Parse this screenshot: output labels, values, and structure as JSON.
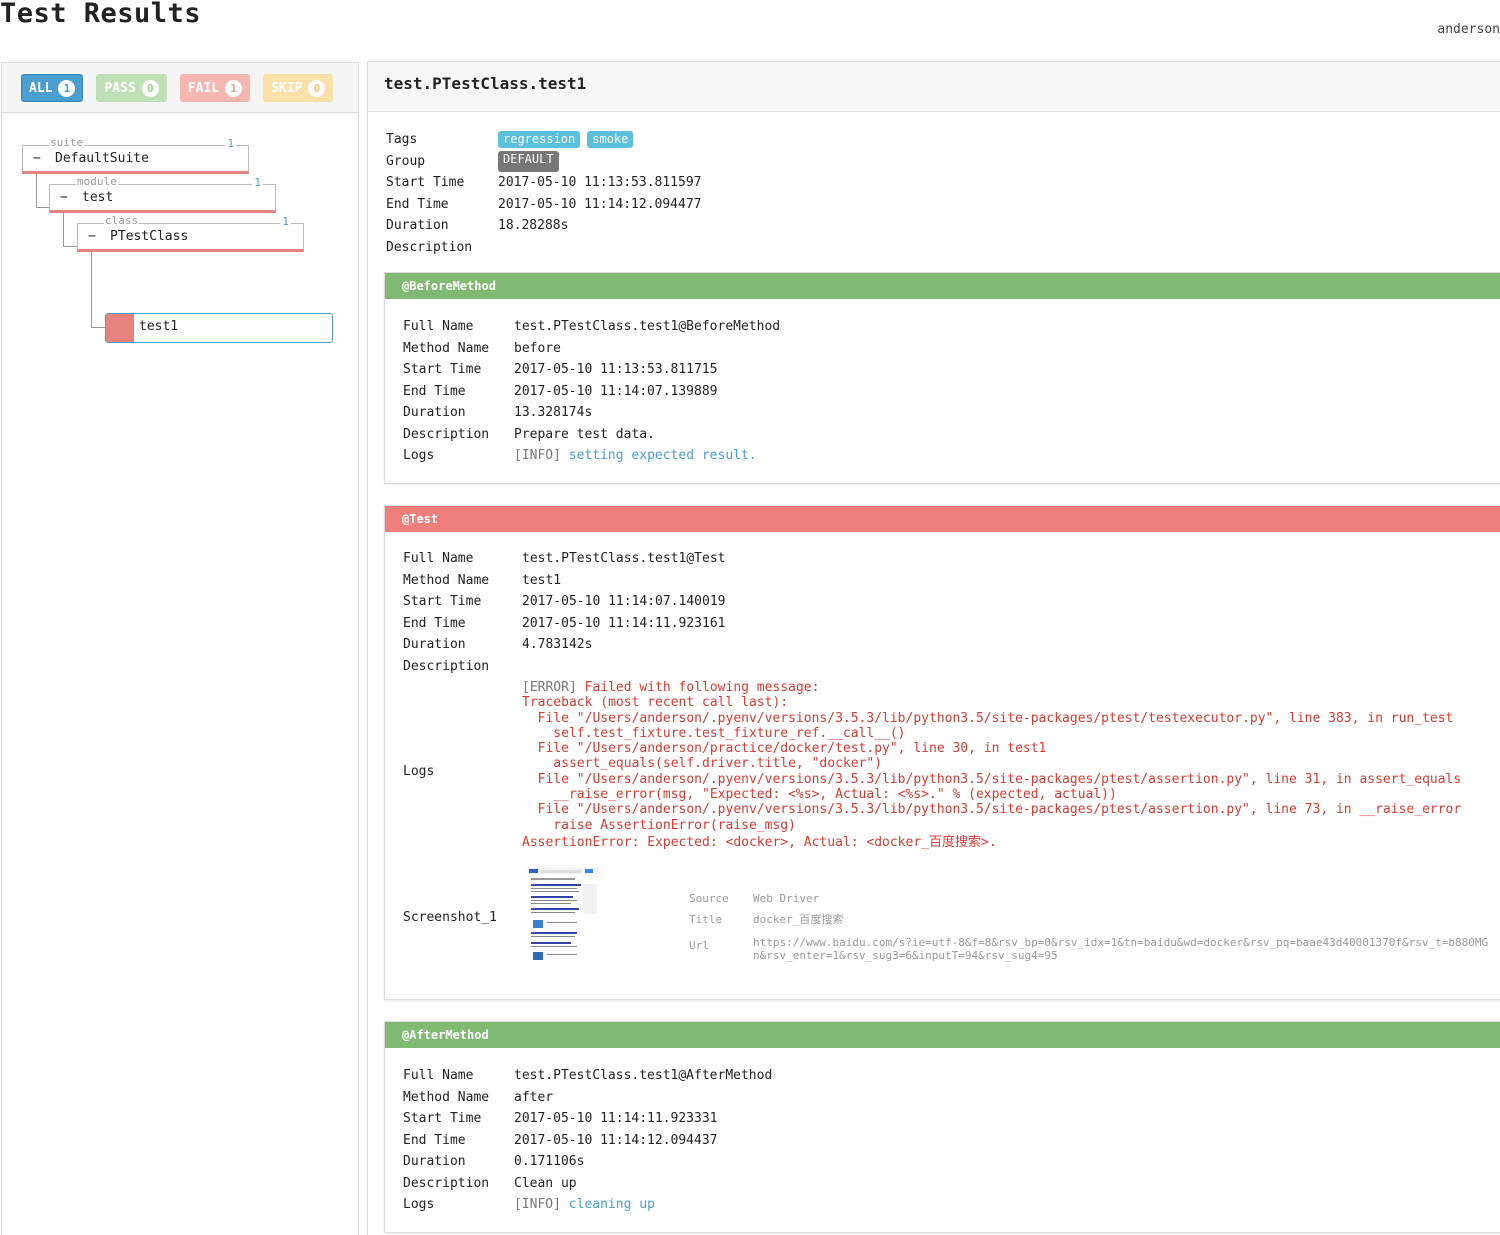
{
  "header": {
    "title": "Test Results",
    "user": "anderson"
  },
  "filters": [
    {
      "label": "ALL",
      "count": "1"
    },
    {
      "label": "PASS",
      "count": "0"
    },
    {
      "label": "FAIL",
      "count": "1"
    },
    {
      "label": "SKIP",
      "count": "0"
    }
  ],
  "tree": {
    "suite": {
      "tag": "suite",
      "name": "DefaultSuite",
      "count": "1",
      "toggle": "−"
    },
    "module": {
      "tag": "module",
      "name": "test",
      "count": "1",
      "toggle": "−"
    },
    "class": {
      "tag": "class",
      "name": "PTestClass",
      "count": "1",
      "toggle": "−"
    },
    "test": {
      "name": "test1",
      "status": "fail"
    }
  },
  "detail": {
    "title": "test.PTestClass.test1",
    "labels": {
      "tags": "Tags",
      "group": "Group",
      "start": "Start Time",
      "end": "End Time",
      "duration": "Duration",
      "description": "Description"
    },
    "tags": [
      "regression",
      "smoke"
    ],
    "group": "DEFAULT",
    "start": "2017-05-10 11:13:53.811597",
    "end": "2017-05-10 11:14:12.094477",
    "duration": "18.28288s",
    "description": ""
  },
  "field_labels": {
    "full_name": "Full Name",
    "method_name": "Method Name",
    "start": "Start Time",
    "end": "End Time",
    "duration": "Duration",
    "description": "Description",
    "logs": "Logs"
  },
  "before": {
    "header": "@BeforeMethod",
    "full_name": "test.PTestClass.test1@BeforeMethod",
    "method_name": "before",
    "start": "2017-05-10 11:13:53.811715",
    "end": "2017-05-10 11:14:07.139889",
    "duration": "13.328174s",
    "description": "Prepare test data.",
    "log_level": "[INFO]",
    "log_msg": "setting expected result."
  },
  "test": {
    "header": "@Test",
    "full_name": "test.PTestClass.test1@Test",
    "method_name": "test1",
    "start": "2017-05-10 11:14:07.140019",
    "end": "2017-05-10 11:14:11.923161",
    "duration": "4.783142s",
    "description": "",
    "log_level": "[ERROR]",
    "log_lines": [
      " Failed with following message:",
      "Traceback (most recent call last):",
      "  File \"/Users/anderson/.pyenv/versions/3.5.3/lib/python3.5/site-packages/ptest/testexecutor.py\", line 383, in run_test",
      "    self.test_fixture.test_fixture_ref.__call__()",
      "  File \"/Users/anderson/practice/docker/test.py\", line 30, in test1",
      "    assert_equals(self.driver.title, \"docker\")",
      "  File \"/Users/anderson/.pyenv/versions/3.5.3/lib/python3.5/site-packages/ptest/assertion.py\", line 31, in assert_equals",
      "    __raise_error(msg, \"Expected: <%s>, Actual: <%s>.\" % (expected, actual))",
      "  File \"/Users/anderson/.pyenv/versions/3.5.3/lib/python3.5/site-packages/ptest/assertion.py\", line 73, in __raise_error",
      "    raise AssertionError(raise_msg)",
      "AssertionError: Expected: <docker>, Actual: <docker_百度搜索>."
    ],
    "screenshot": {
      "label": "Screenshot_1",
      "source_label": "Source",
      "source": "Web Driver",
      "title_label": "Title",
      "title": "docker_百度搜索",
      "url_label": "Url",
      "url_line1": "https://www.baidu.com/s?ie=utf-8&f=8&rsv_bp=0&rsv_idx=1&tn=baidu&wd=docker&rsv_pq=baae43d40001370f&rsv_t=b880MG",
      "url_line2": "n&rsv_enter=1&rsv_sug3=6&inputT=94&rsv_sug4=95"
    }
  },
  "after": {
    "header": "@AfterMethod",
    "full_name": "test.PTestClass.test1@AfterMethod",
    "method_name": "after",
    "start": "2017-05-10 11:14:11.923331",
    "end": "2017-05-10 11:14:12.094437",
    "duration": "0.171106s",
    "description": "Clean up",
    "log_level": "[INFO]",
    "log_msg": "cleaning up"
  },
  "colors": {
    "pass": "#80b972",
    "fail": "#ef7f7a",
    "accent": "#4a9ed0"
  }
}
